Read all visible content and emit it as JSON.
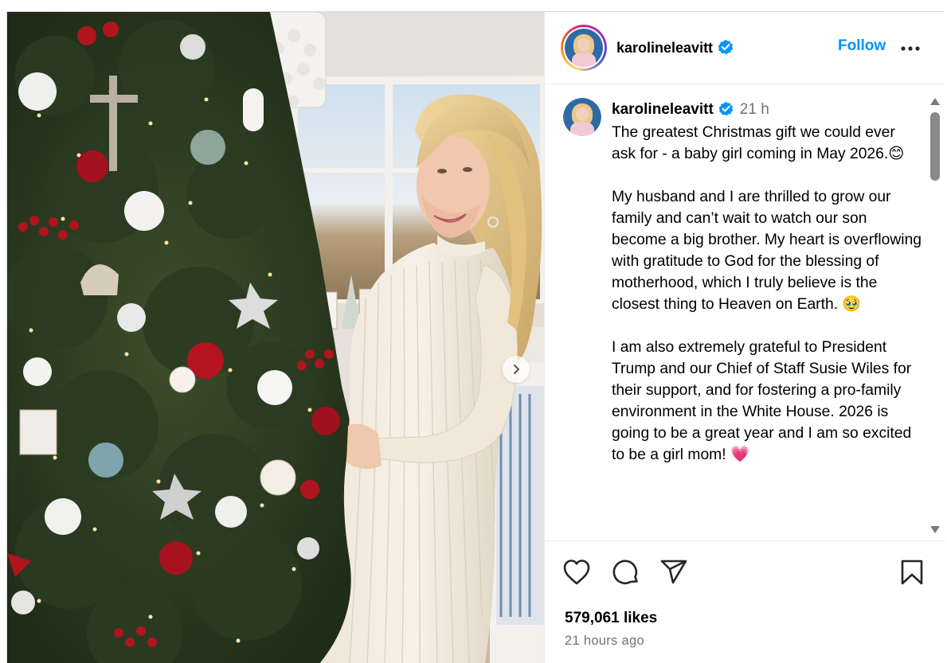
{
  "post": {
    "username": "karolineleavitt",
    "verified": true,
    "follow_label": "Follow",
    "more_icon": "more-horizontal-icon",
    "caption": {
      "username": "karolineleavitt",
      "time": "21 h",
      "text": "The greatest Christmas gift we could ever ask for - a baby girl coming in May 2026.😊\n\nMy husband and I are thrilled to grow our family and can’t wait to watch our son become a big brother. My heart is overflowing with gratitude to God for the blessing of motherhood, which I truly believe is the closest thing to Heaven on Earth. 🥹\n\nI am also extremely grateful to President Trump and our Chief of Staff Susie Wiles for their support, and for fostering a pro-family environment in the White House. 2026 is going to be a great year and I am so excited to be a girl mom! 💗"
    },
    "likes": "579,061 likes",
    "posted_ago": "21 hours ago",
    "icons": [
      "heart-icon",
      "comment-icon",
      "share-icon",
      "bookmark-icon",
      "chevron-right-icon",
      "verified-badge-icon"
    ],
    "colors": {
      "follow": "#0095f6",
      "verified": "#0095f6",
      "muted": "#737373"
    }
  }
}
